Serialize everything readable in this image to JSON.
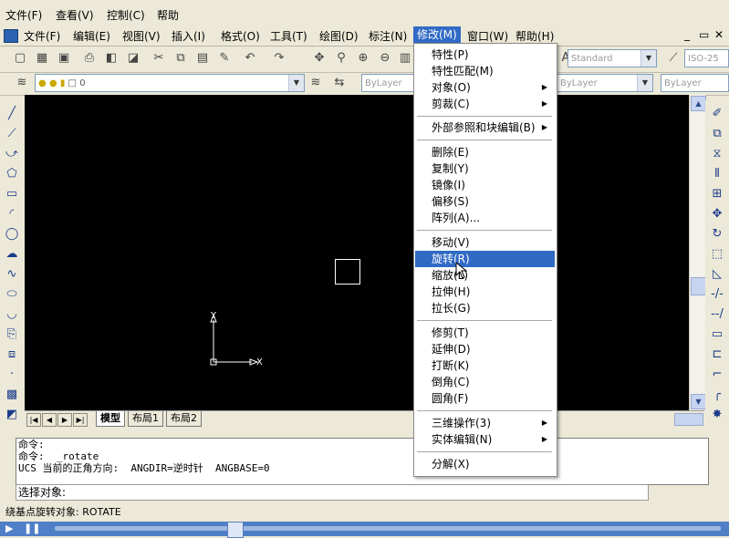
{
  "outer_menu": [
    "文件(F)",
    "查看(V)",
    "控制(C)",
    "帮助"
  ],
  "inner_menu": [
    "文件(F)",
    "编辑(E)",
    "视图(V)",
    "插入(I)",
    "格式(O)",
    "工具(T)",
    "绘图(D)",
    "标注(N)",
    "修改(M)",
    "窗口(W)",
    "帮助(H)"
  ],
  "window_buttons": [
    "_",
    "▭",
    "✕"
  ],
  "text_style": "Standard",
  "dim_style": "ISO-25",
  "layer_value": "0",
  "bylayer": [
    "ByLayer",
    "ByLayer",
    "ByLayer"
  ],
  "tabs": [
    "模型",
    "布局1",
    "布局2"
  ],
  "command_lines": [
    "命令:",
    "命令:  _rotate",
    "UCS 当前的正角方向:  ANGDIR=逆时针  ANGBASE=0"
  ],
  "command_prompt": "选择对象:",
  "status_text": "绕基点旋转对象:  ROTATE",
  "ucs": {
    "y": "Y",
    "x": "X"
  },
  "modify_menu": {
    "items": [
      {
        "label": "特性(P)"
      },
      {
        "label": "特性匹配(M)"
      },
      {
        "label": "对象(O)",
        "submenu": true
      },
      {
        "label": "剪裁(C)",
        "submenu": true
      },
      {
        "label": "外部参照和块编辑(B)",
        "submenu": true
      },
      {
        "label": "删除(E)"
      },
      {
        "label": "复制(Y)"
      },
      {
        "label": "镜像(I)"
      },
      {
        "label": "偏移(S)"
      },
      {
        "label": "阵列(A)..."
      },
      {
        "label": "移动(V)"
      },
      {
        "label": "旋转(R)",
        "highlighted": true
      },
      {
        "label": "缩放(L)"
      },
      {
        "label": "拉伸(H)"
      },
      {
        "label": "拉长(G)"
      },
      {
        "label": "修剪(T)"
      },
      {
        "label": "延伸(D)"
      },
      {
        "label": "打断(K)"
      },
      {
        "label": "倒角(C)"
      },
      {
        "label": "圆角(F)"
      },
      {
        "label": "三维操作(3)",
        "submenu": true
      },
      {
        "label": "实体编辑(N)",
        "submenu": true
      },
      {
        "label": "分解(X)"
      }
    ]
  },
  "colors": {
    "canvas": "#000000",
    "menu_highlight": "#316ac5",
    "chrome": "#ece9d8",
    "player": "#4f7fc7"
  }
}
